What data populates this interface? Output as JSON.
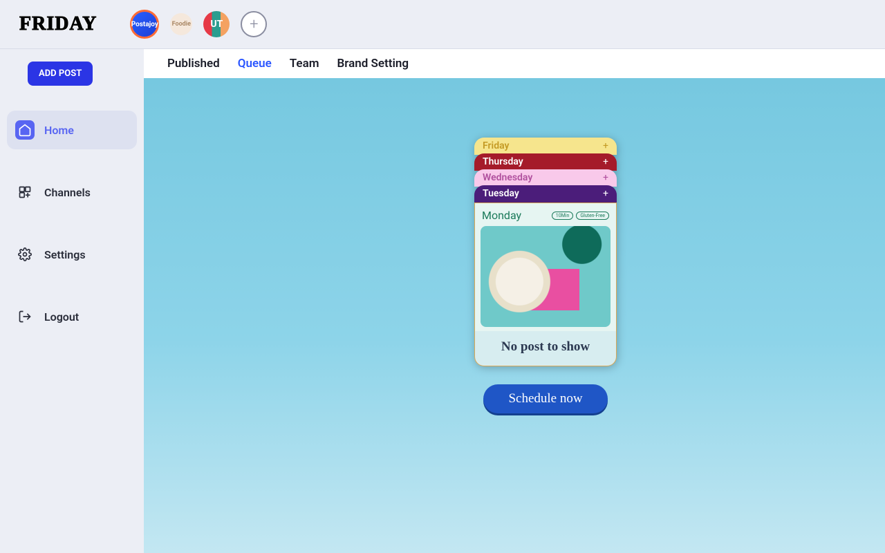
{
  "app": {
    "logo_text": "FRIDAY"
  },
  "topbar": {
    "avatars": [
      {
        "name": "Postajoy"
      },
      {
        "name": "Foodie"
      },
      {
        "name": "UT"
      }
    ],
    "add_label": "+"
  },
  "sidebar": {
    "add_post_label": "ADD POST",
    "items": [
      {
        "label": "Home",
        "icon": "home-icon",
        "active": true
      },
      {
        "label": "Channels",
        "icon": "channels-icon",
        "active": false
      },
      {
        "label": "Settings",
        "icon": "settings-icon",
        "active": false
      },
      {
        "label": "Logout",
        "icon": "logout-icon",
        "active": false
      }
    ]
  },
  "tabs": [
    {
      "label": "Published",
      "active": false
    },
    {
      "label": "Queue",
      "active": true
    },
    {
      "label": "Team",
      "active": false
    },
    {
      "label": "Brand Setting",
      "active": false
    }
  ],
  "schedule_card": {
    "days": [
      {
        "label": "Friday",
        "plus": "+"
      },
      {
        "label": "Thursday",
        "plus": "+"
      },
      {
        "label": "Wednesday",
        "plus": "+"
      },
      {
        "label": "Tuesday",
        "plus": "+"
      }
    ],
    "monday": {
      "label": "Monday",
      "badges": [
        "10Min",
        "Gluten-Free"
      ]
    },
    "empty_text": "No post to show",
    "cta": "Schedule now"
  }
}
